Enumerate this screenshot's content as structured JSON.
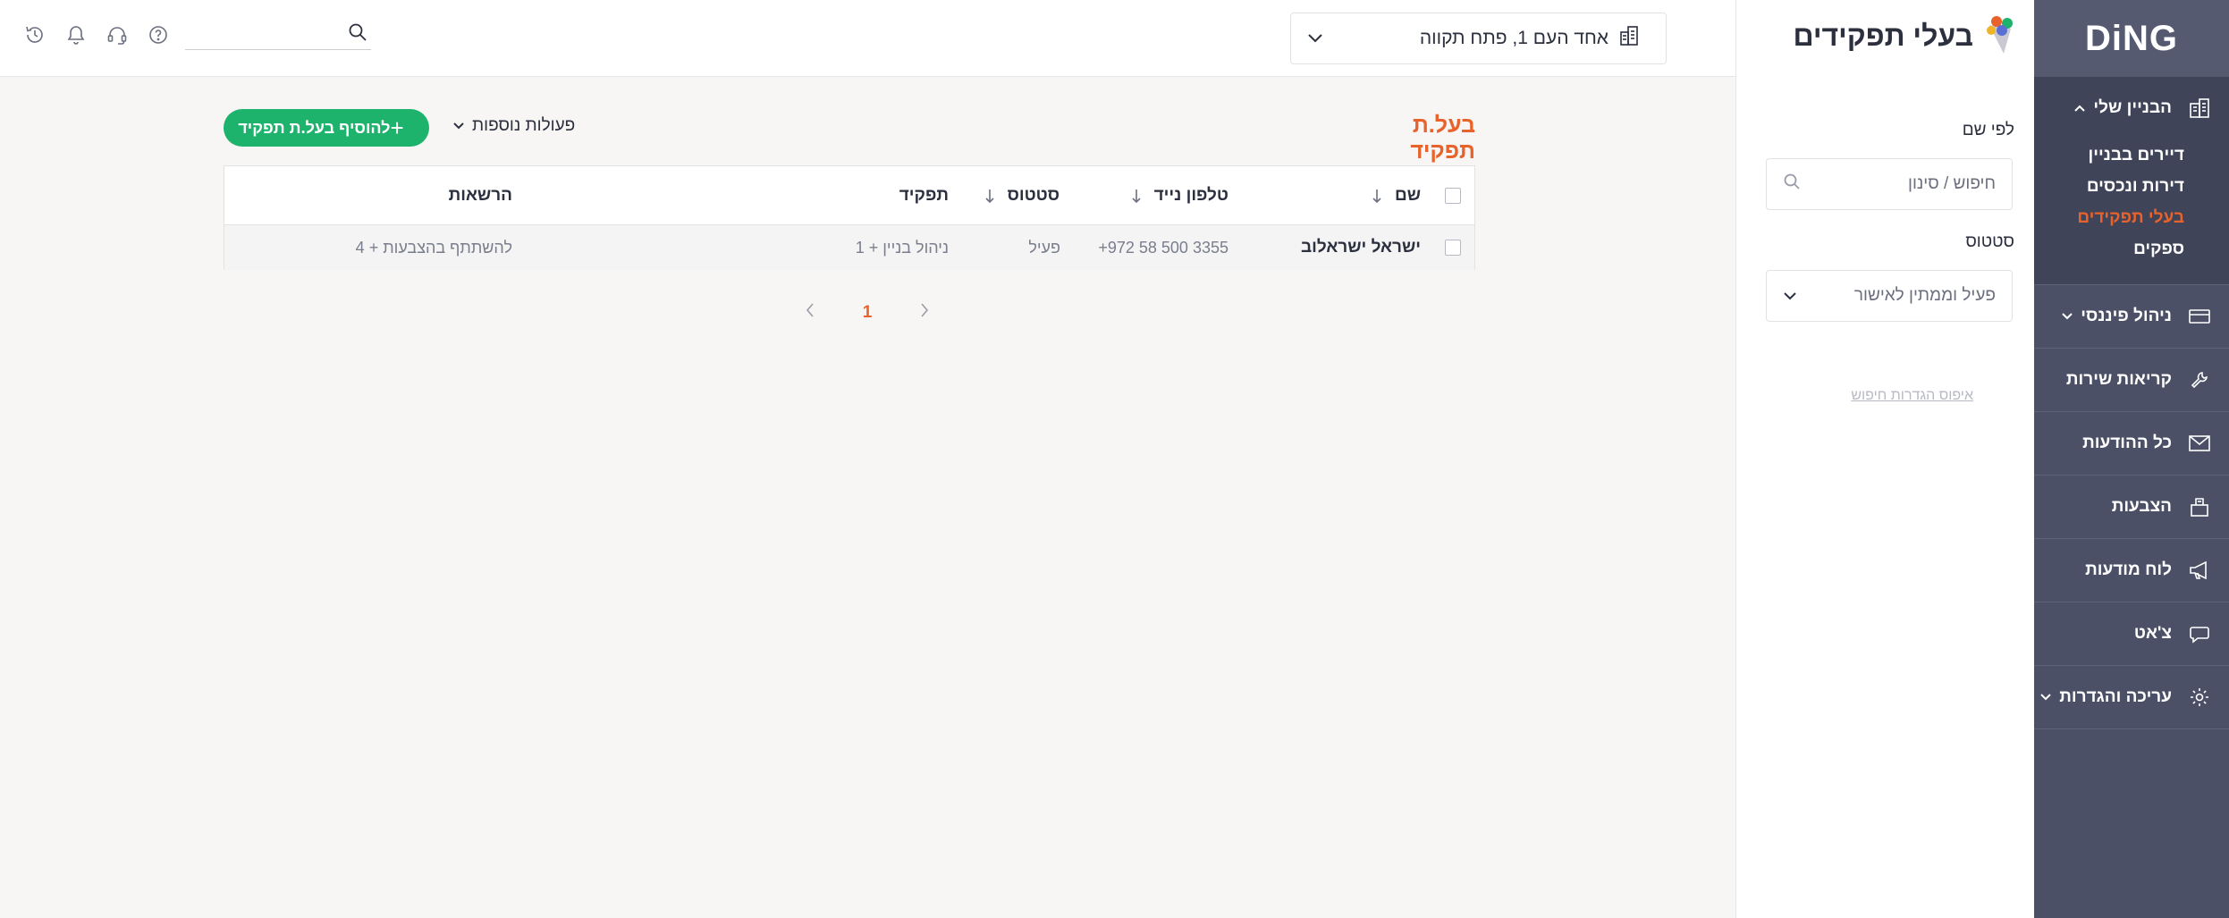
{
  "brand": {
    "logo_text": "DiNG"
  },
  "sidebar": {
    "group": {
      "label": "הבניין שלי",
      "items": [
        {
          "label": "דיירים בבניין",
          "active": false
        },
        {
          "label": "דירות ונכסים",
          "active": false
        },
        {
          "label": "בעלי תפקידים",
          "active": true
        },
        {
          "label": "ספקים",
          "active": false
        }
      ]
    },
    "items": [
      {
        "label": "ניהול פיננסי",
        "icon": "credit-card-icon",
        "has_chevron": true
      },
      {
        "label": "קריאות שירות",
        "icon": "wrench-icon",
        "has_chevron": false
      },
      {
        "label": "כל ההודעות",
        "icon": "envelope-icon",
        "has_chevron": false
      },
      {
        "label": "הצבעות",
        "icon": "ballot-box-icon",
        "has_chevron": false
      },
      {
        "label": "לוח מודעות",
        "icon": "megaphone-icon",
        "has_chevron": false
      },
      {
        "label": "צ'אט",
        "icon": "chat-icon",
        "has_chevron": false
      },
      {
        "label": "עריכה והגדרות",
        "icon": "gear-icon",
        "has_chevron": true
      }
    ]
  },
  "filter_panel": {
    "title": "בעלי תפקידים",
    "by_name_label": "לפי שם",
    "search_placeholder": "חיפוש / סינון",
    "status_label": "סטטוס",
    "status_value": "פעיל וממתין לאישור",
    "reset_label": "איפוס הגדרות חיפוש"
  },
  "topbar": {
    "building": "אחד העם 1, פתח תקווה",
    "search_value": ""
  },
  "main": {
    "title": "בעל.ת תפקיד",
    "more_actions": "פעולות נוספות",
    "add_button": "להוסיף בעל.ת תפקיד",
    "columns": {
      "name": "שם",
      "phone": "טלפון נייד",
      "status": "סטטוס",
      "role": "תפקיד",
      "permissions": "הרשאות"
    },
    "rows": [
      {
        "name": "ישראל ישראלוב",
        "phone": "+972 58 500 3355",
        "status": "פעיל",
        "role": "ניהול בניין + 1",
        "permissions": "להשתתף בהצבעות + 4"
      }
    ],
    "pagination": {
      "current_page": "1"
    }
  },
  "colors": {
    "accent": "#e8622b",
    "primary_button": "#1db36d",
    "sidebar_bg": "#4b5066",
    "sidebar_group_bg": "#3f4459"
  }
}
